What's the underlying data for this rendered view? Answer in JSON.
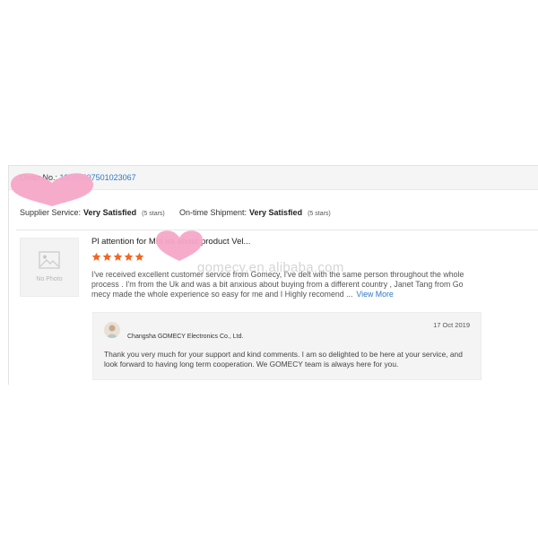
{
  "order": {
    "label": "Order No.:",
    "number": "19055507501023067"
  },
  "ratings": {
    "supplier_service_label": "Supplier Service:",
    "supplier_service_value": "Very Satisfied",
    "supplier_service_count": "(5 stars)",
    "shipment_label": "On-time Shipment:",
    "shipment_value": "Very Satisfied",
    "shipment_count": "(5 stars)"
  },
  "product": {
    "no_photo": "No Photo",
    "icon": "image-placeholder-icon"
  },
  "review": {
    "title": "Pl attention for Mrs            ira about product Vel...",
    "stars": 5,
    "star_color": "#f26522",
    "text": "I've received excellent customer service from Gomecy, I've delt with the same person throughout the whole process . I'm from the Uk and was a bit anxious about buying from a different country , Janet Tang from Go mecy made the whole experience so easy for me and I Highly recomend ...",
    "more_link": "View More"
  },
  "reply": {
    "company": "Changsha GOMECY Electronics Co., Ltd.",
    "date": "17 Oct 2019",
    "message": "Thank you very much for your support and kind comments. I am so delighted to be here at your service, and look forward to having long term cooperation. We GOMECY team is always here for you."
  },
  "watermark": "gomecy.en.alibaba.com",
  "colors": {
    "link": "#2f78c4",
    "star": "#f26522",
    "heart": "#f7a6c8"
  }
}
